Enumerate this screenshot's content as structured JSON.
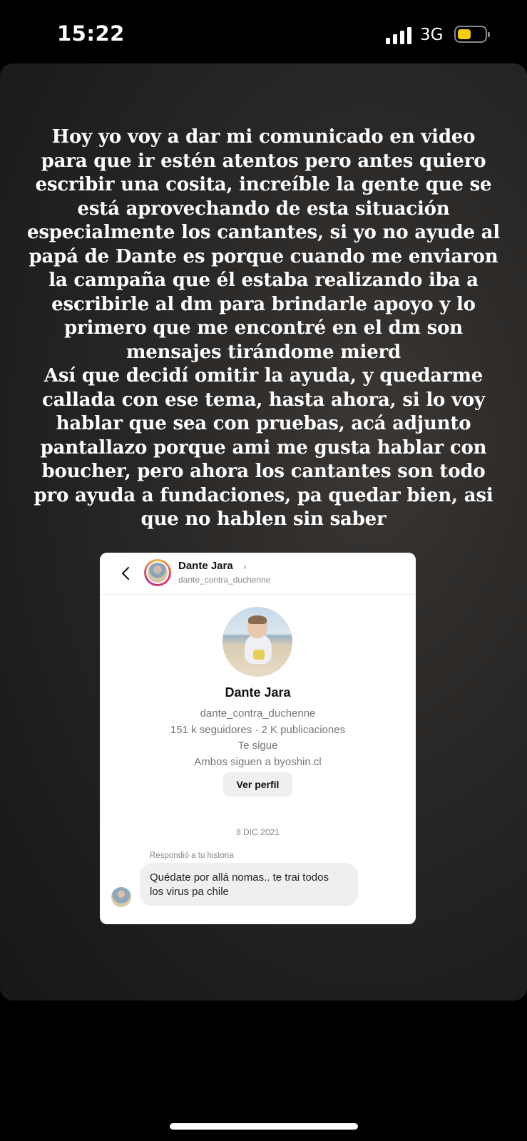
{
  "status_bar": {
    "time": "15:22",
    "network": "3G",
    "icons": [
      "signal-icon",
      "battery-icon"
    ],
    "battery_color": "#f4cd05"
  },
  "story": {
    "text": "Hoy yo voy a dar mi comunicado en video\npara que ir estén atentos pero antes quiero\nescribir una cosita, increíble la gente que se\nestá aprovechando de esta situación\nespecialmente los cantantes, si yo no ayude al\npapá de Dante es porque cuando me enviaron\nla campaña que él estaba realizando iba a\nescribirle al dm para brindarle apoyo y lo\nprimero que me encontré en el dm son\nmensajes tirándome mierd\nAsí que decidí omitir la ayuda, y quedarme\ncallada con ese tema, hasta ahora, si lo voy\nhablar que sea con pruebas, acá adjunto\npantallazo porque ami me gusta hablar con\nboucher, pero ahora los cantantes son todo\npro ayuda a fundaciones, pa quedar bien, asi\nque no hablen sin saber"
  },
  "dm": {
    "header": {
      "name": "Dante Jara",
      "chevron": "›",
      "username": "dante_contra_duchenne"
    },
    "profile": {
      "name": "Dante Jara",
      "username": "dante_contra_duchenne",
      "stats": "151 k seguidores · 2 K publicaciones",
      "follows_you": "Te sigue",
      "mutual": "Ambos siguen a byoshin.cl",
      "button": "Ver perfil"
    },
    "date": "8 DIC 2021",
    "reply_label": "Respondió a tu historia",
    "message": "Quédate por allá nomas.. te trai todos\nlos virus pa chile"
  }
}
